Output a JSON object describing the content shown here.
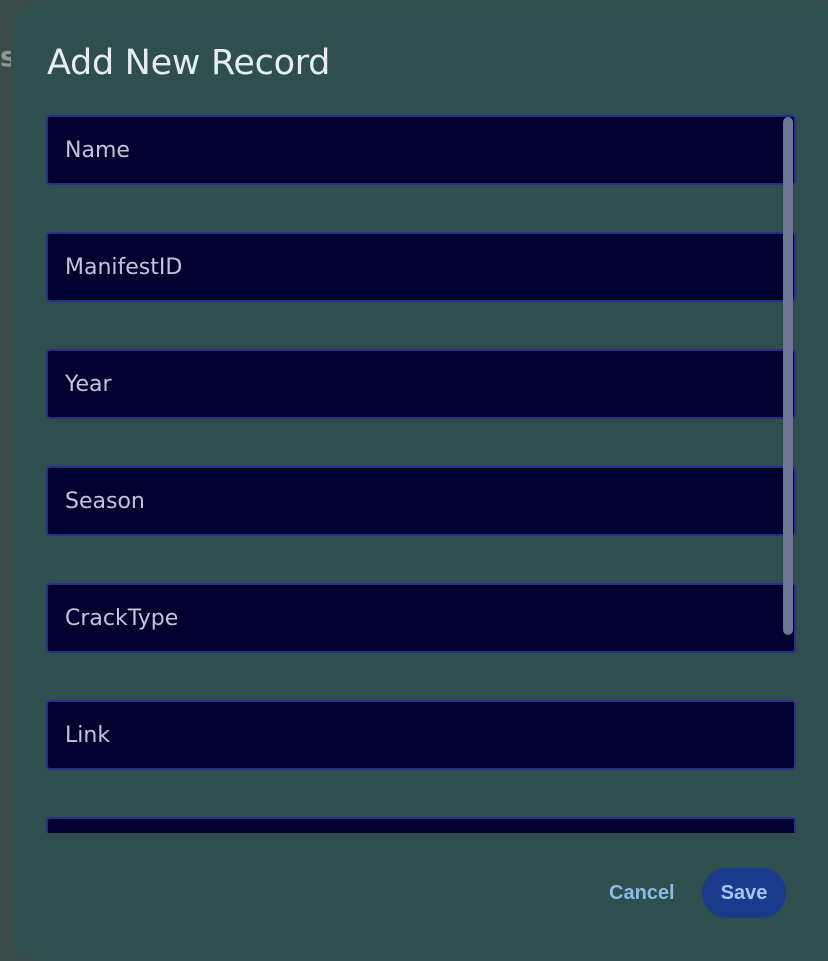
{
  "backdrop": {
    "fragment": "s"
  },
  "dialog": {
    "title": "Add New Record",
    "fields": [
      {
        "placeholder": "Name",
        "value": ""
      },
      {
        "placeholder": "ManifestID",
        "value": ""
      },
      {
        "placeholder": "Year",
        "value": ""
      },
      {
        "placeholder": "Season",
        "value": ""
      },
      {
        "placeholder": "CrackType",
        "value": ""
      },
      {
        "placeholder": "Link",
        "value": ""
      },
      {
        "placeholder": "",
        "value": ""
      }
    ],
    "actions": {
      "cancel_label": "Cancel",
      "save_label": "Save"
    }
  },
  "colors": {
    "dialog_bg": "#2e4f4d",
    "field_bg": "#02002e",
    "field_border": "#2a2d8a",
    "cancel_text": "#8db9f0",
    "save_bg": "#1a3a8c"
  }
}
